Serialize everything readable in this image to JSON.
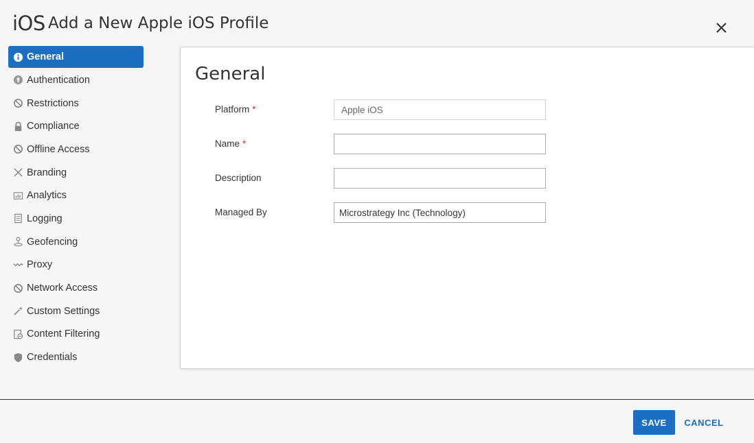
{
  "header": {
    "os_label": "iOS",
    "title": "Add a New Apple iOS Profile"
  },
  "sidebar": {
    "items": [
      {
        "label": "General",
        "icon": "info-icon",
        "active": true
      },
      {
        "label": "Authentication",
        "icon": "keyhole-icon"
      },
      {
        "label": "Restrictions",
        "icon": "no-entry-icon"
      },
      {
        "label": "Compliance",
        "icon": "lock-icon"
      },
      {
        "label": "Offline Access",
        "icon": "no-entry-icon"
      },
      {
        "label": "Branding",
        "icon": "brush-icon"
      },
      {
        "label": "Analytics",
        "icon": "chart-icon"
      },
      {
        "label": "Logging",
        "icon": "scroll-icon"
      },
      {
        "label": "Geofencing",
        "icon": "location-pin-icon"
      },
      {
        "label": "Proxy",
        "icon": "wave-icon"
      },
      {
        "label": "Network Access",
        "icon": "no-entry-icon"
      },
      {
        "label": "Custom Settings",
        "icon": "magic-wand-icon"
      },
      {
        "label": "Content Filtering",
        "icon": "filter-doc-icon"
      },
      {
        "label": "Credentials",
        "icon": "shield-icon"
      }
    ]
  },
  "main": {
    "title": "General",
    "fields": {
      "platform": {
        "label": "Platform",
        "required": "*",
        "value": "Apple iOS"
      },
      "name": {
        "label": "Name",
        "required": "*",
        "value": ""
      },
      "description": {
        "label": "Description",
        "value": ""
      },
      "managed_by": {
        "label": "Managed By",
        "value": "Microstrategy Inc (Technology)"
      }
    }
  },
  "footer": {
    "save_label": "SAVE",
    "cancel_label": "CANCEL"
  },
  "colors": {
    "accent": "#1b6ec2",
    "required": "#d32f2f"
  }
}
